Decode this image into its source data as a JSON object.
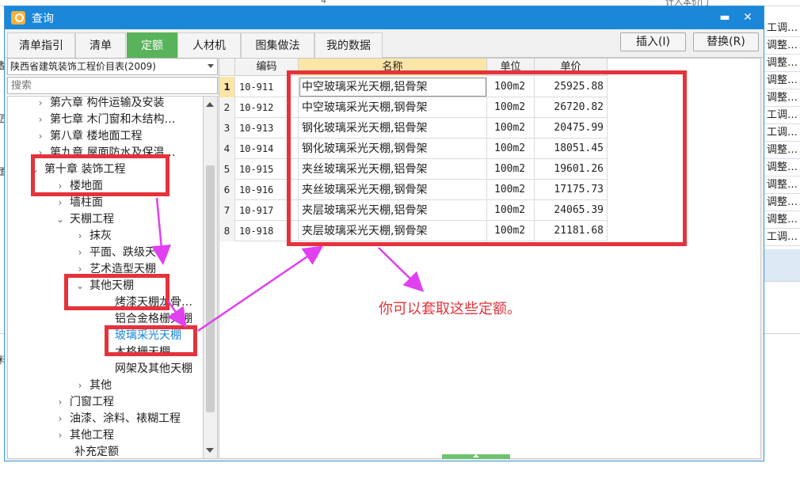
{
  "background": {
    "top_labels": [
      "4",
      "计入本价门"
    ],
    "right_column": [
      "工调…",
      "调整…",
      "调整…",
      "调整…",
      "调整…",
      "工调…",
      "工调…",
      "调整…",
      "调整…",
      "调整…",
      "调整…",
      "调整…",
      "工调…"
    ],
    "left_chars": [
      "整",
      "匠",
      "面",
      "料"
    ]
  },
  "dialog": {
    "title": "查询",
    "minimize": "▬",
    "close": "✕"
  },
  "tabs": [
    {
      "label": "清单指引"
    },
    {
      "label": "清单"
    },
    {
      "label": "定额"
    },
    {
      "label": "人材机"
    },
    {
      "label": "图集做法"
    },
    {
      "label": "我的数据"
    }
  ],
  "toolbar": {
    "insert_label": "插入(I)",
    "replace_label": "替换(R)"
  },
  "left": {
    "library": "陕西省建筑装饰工程价目表(2009)",
    "search_placeholder": "搜索",
    "tree": [
      {
        "label": "第六章  构件运输及安装",
        "chevron": "›"
      },
      {
        "label": "第七章  木门窗和木结构…",
        "chevron": "›"
      },
      {
        "label": "第八章  楼地面工程",
        "chevron": "›"
      },
      {
        "label": "第九章  屋面防水及保温…",
        "chevron": "›"
      },
      {
        "label": "第十章  装饰工程",
        "chevron": "⌄"
      },
      {
        "label": "楼地面",
        "chevron": "›"
      },
      {
        "label": "墙柱面",
        "chevron": "›"
      },
      {
        "label": "天棚工程",
        "chevron": "⌄"
      },
      {
        "label": "抹灰",
        "chevron": "›"
      },
      {
        "label": "平面、跌级天棚",
        "chevron": "›"
      },
      {
        "label": "艺术造型天棚",
        "chevron": "›"
      },
      {
        "label": "其他天棚",
        "chevron": "⌄"
      },
      {
        "label": "烤漆天棚龙骨…",
        "chevron": ""
      },
      {
        "label": "铝合金格栅天棚",
        "chevron": ""
      },
      {
        "label": "玻璃采光天棚",
        "chevron": ""
      },
      {
        "label": "木格栅天棚",
        "chevron": ""
      },
      {
        "label": "网架及其他天棚",
        "chevron": ""
      },
      {
        "label": "其他",
        "chevron": "›"
      },
      {
        "label": "门窗工程",
        "chevron": "›"
      },
      {
        "label": "油漆、涂料、裱糊工程",
        "chevron": "›"
      },
      {
        "label": "其他工程",
        "chevron": "›"
      },
      {
        "label": "补充定额",
        "chevron": ""
      }
    ]
  },
  "grid": {
    "headers": {
      "code": "编码",
      "name": "名称",
      "unit": "单位",
      "price": "单价"
    },
    "rows": [
      {
        "n": "1",
        "code": "10-911",
        "name": "中空玻璃采光天棚,铝骨架",
        "unit": "100m2",
        "price": "25925.88"
      },
      {
        "n": "2",
        "code": "10-912",
        "name": "中空玻璃采光天棚,钢骨架",
        "unit": "100m2",
        "price": "26720.82"
      },
      {
        "n": "3",
        "code": "10-913",
        "name": "钢化玻璃采光天棚,铝骨架",
        "unit": "100m2",
        "price": "20475.99"
      },
      {
        "n": "4",
        "code": "10-914",
        "name": "钢化玻璃采光天棚,钢骨架",
        "unit": "100m2",
        "price": "18051.45"
      },
      {
        "n": "5",
        "code": "10-915",
        "name": "夹丝玻璃采光天棚,铝骨架",
        "unit": "100m2",
        "price": "19601.26"
      },
      {
        "n": "6",
        "code": "10-916",
        "name": "夹丝玻璃采光天棚,钢骨架",
        "unit": "100m2",
        "price": "17175.73"
      },
      {
        "n": "7",
        "code": "10-917",
        "name": "夹层玻璃采光天棚,铝骨架",
        "unit": "100m2",
        "price": "24065.39"
      },
      {
        "n": "8",
        "code": "10-918",
        "name": "夹层玻璃采光天棚,钢骨架",
        "unit": "100m2",
        "price": "21181.68"
      }
    ]
  },
  "annotation": {
    "note": "你可以套取这些定额。",
    "color": "#e5323b",
    "arrow_color": "#e040f0"
  }
}
